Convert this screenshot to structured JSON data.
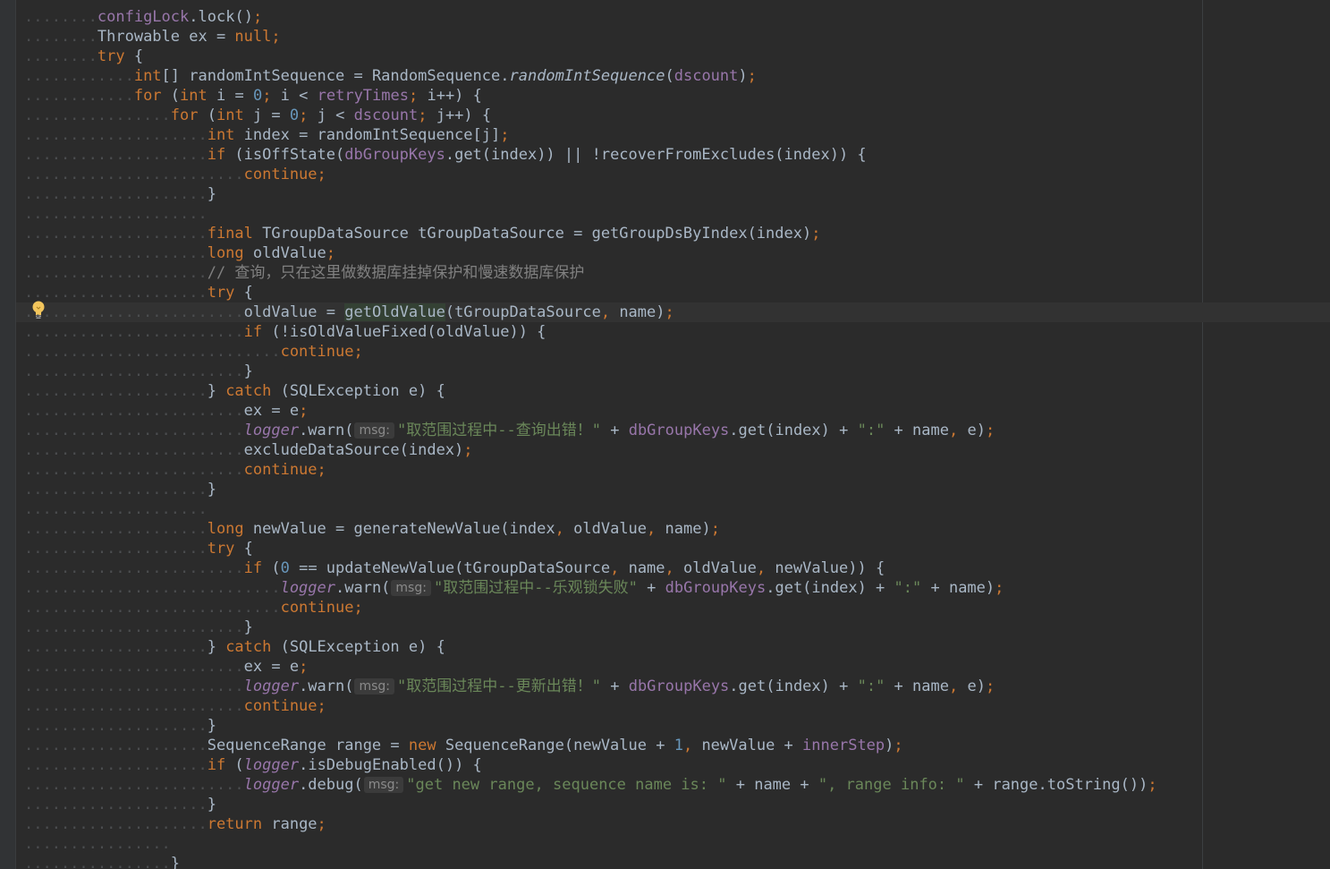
{
  "editor": {
    "inlay_hint_label": "msg:",
    "lines": [
      {
        "indent": 2,
        "tokens": [
          [
            "fld",
            "configLock"
          ],
          [
            "",
            "."
          ],
          [
            "",
            "lock"
          ],
          [
            "",
            "()"
          ],
          [
            "kw",
            ";"
          ]
        ]
      },
      {
        "indent": 2,
        "tokens": [
          [
            "",
            "Throwable ex = "
          ],
          [
            "kw",
            "null"
          ],
          [
            "kw",
            ";"
          ]
        ]
      },
      {
        "indent": 2,
        "tokens": [
          [
            "kw",
            "try"
          ],
          [
            "",
            " {"
          ]
        ]
      },
      {
        "indent": 3,
        "tokens": [
          [
            "kw",
            "int"
          ],
          [
            "",
            "[] randomIntSequence = RandomSequence."
          ],
          [
            "it",
            "randomIntSequence"
          ],
          [
            "",
            "("
          ],
          [
            "fld",
            "dscount"
          ],
          [
            "",
            ")"
          ],
          [
            "kw",
            ";"
          ]
        ]
      },
      {
        "indent": 3,
        "tokens": [
          [
            "kw",
            "for"
          ],
          [
            "",
            " ("
          ],
          [
            "kw",
            "int"
          ],
          [
            "",
            " i = "
          ],
          [
            "num",
            "0"
          ],
          [
            "kw",
            ";"
          ],
          [
            "",
            " i < "
          ],
          [
            "fld",
            "retryTimes"
          ],
          [
            "kw",
            ";"
          ],
          [
            "",
            " i++) {"
          ]
        ]
      },
      {
        "indent": 4,
        "tokens": [
          [
            "kw",
            "for"
          ],
          [
            "",
            " ("
          ],
          [
            "kw",
            "int"
          ],
          [
            "",
            " j = "
          ],
          [
            "num",
            "0"
          ],
          [
            "kw",
            ";"
          ],
          [
            "",
            " j < "
          ],
          [
            "fld",
            "dscount"
          ],
          [
            "kw",
            ";"
          ],
          [
            "",
            " j++) {"
          ]
        ]
      },
      {
        "indent": 5,
        "tokens": [
          [
            "kw",
            "int"
          ],
          [
            "",
            " index = randomIntSequence[j]"
          ],
          [
            "kw",
            ";"
          ]
        ]
      },
      {
        "indent": 5,
        "tokens": [
          [
            "kw",
            "if"
          ],
          [
            "",
            " (isOffState("
          ],
          [
            "fld",
            "dbGroupKeys"
          ],
          [
            "",
            ".get(index)) || !recoverFromExcludes(index)) {"
          ]
        ]
      },
      {
        "indent": 6,
        "tokens": [
          [
            "kw",
            "continue"
          ],
          [
            "kw",
            ";"
          ]
        ]
      },
      {
        "indent": 5,
        "tokens": [
          [
            "",
            "}"
          ]
        ]
      },
      {
        "indent": 5,
        "blank": true,
        "tokens": []
      },
      {
        "indent": 5,
        "tokens": [
          [
            "kw",
            "final"
          ],
          [
            "",
            " TGroupDataSource tGroupDataSource = getGroupDsByIndex(index)"
          ],
          [
            "kw",
            ";"
          ]
        ]
      },
      {
        "indent": 5,
        "tokens": [
          [
            "kw",
            "long"
          ],
          [
            "",
            " oldValue"
          ],
          [
            "kw",
            ";"
          ]
        ]
      },
      {
        "indent": 5,
        "tokens": [
          [
            "cmt",
            "// 查询，只在这里做数据库挂掉保护和慢速数据库保护"
          ]
        ]
      },
      {
        "indent": 5,
        "tokens": [
          [
            "kw",
            "try"
          ],
          [
            "",
            " {"
          ]
        ]
      },
      {
        "indent": 6,
        "caret": true,
        "tokens": [
          [
            "",
            "oldValue = "
          ],
          [
            "hl",
            "getOldValue"
          ],
          [
            "",
            "(tGroupDataSource"
          ],
          [
            "kw",
            ","
          ],
          [
            "",
            " name)"
          ],
          [
            "kw",
            ";"
          ]
        ]
      },
      {
        "indent": 6,
        "tokens": [
          [
            "kw",
            "if"
          ],
          [
            "",
            " (!isOldValueFixed(oldValue)) {"
          ]
        ]
      },
      {
        "indent": 7,
        "tokens": [
          [
            "kw",
            "continue"
          ],
          [
            "kw",
            ";"
          ]
        ]
      },
      {
        "indent": 6,
        "tokens": [
          [
            "",
            "}"
          ]
        ]
      },
      {
        "indent": 5,
        "tokens": [
          [
            "",
            "} "
          ],
          [
            "kw",
            "catch"
          ],
          [
            "",
            " (SQLException e) {"
          ]
        ]
      },
      {
        "indent": 6,
        "tokens": [
          [
            "",
            "ex = e"
          ],
          [
            "kw",
            ";"
          ]
        ]
      },
      {
        "indent": 6,
        "tokens": [
          [
            "sfi",
            "logger"
          ],
          [
            "",
            ".warn("
          ],
          [
            "hint",
            ""
          ],
          [
            "str",
            "\"取范围过程中--查询出错！\""
          ],
          [
            "",
            " + "
          ],
          [
            "fld",
            "dbGroupKeys"
          ],
          [
            "",
            ".get(index) + "
          ],
          [
            "str",
            "\":\""
          ],
          [
            "",
            " + name"
          ],
          [
            "kw",
            ","
          ],
          [
            "",
            " e)"
          ],
          [
            "kw",
            ";"
          ]
        ]
      },
      {
        "indent": 6,
        "tokens": [
          [
            "",
            "excludeDataSource(index)"
          ],
          [
            "kw",
            ";"
          ]
        ]
      },
      {
        "indent": 6,
        "tokens": [
          [
            "kw",
            "continue"
          ],
          [
            "kw",
            ";"
          ]
        ]
      },
      {
        "indent": 5,
        "tokens": [
          [
            "",
            "}"
          ]
        ]
      },
      {
        "indent": 5,
        "blank": true,
        "tokens": []
      },
      {
        "indent": 5,
        "tokens": [
          [
            "kw",
            "long"
          ],
          [
            "",
            " newValue = generateNewValue(index"
          ],
          [
            "kw",
            ","
          ],
          [
            "",
            " oldValue"
          ],
          [
            "kw",
            ","
          ],
          [
            "",
            " name)"
          ],
          [
            "kw",
            ";"
          ]
        ]
      },
      {
        "indent": 5,
        "tokens": [
          [
            "kw",
            "try"
          ],
          [
            "",
            " {"
          ]
        ]
      },
      {
        "indent": 6,
        "tokens": [
          [
            "kw",
            "if"
          ],
          [
            "",
            " ("
          ],
          [
            "num",
            "0"
          ],
          [
            "",
            " == updateNewValue(tGroupDataSource"
          ],
          [
            "kw",
            ","
          ],
          [
            "",
            " name"
          ],
          [
            "kw",
            ","
          ],
          [
            "",
            " oldValue"
          ],
          [
            "kw",
            ","
          ],
          [
            "",
            " newValue)) {"
          ]
        ]
      },
      {
        "indent": 7,
        "tokens": [
          [
            "sfi",
            "logger"
          ],
          [
            "",
            ".warn("
          ],
          [
            "hint",
            ""
          ],
          [
            "str",
            "\"取范围过程中--乐观锁失败\""
          ],
          [
            "",
            " + "
          ],
          [
            "fld",
            "dbGroupKeys"
          ],
          [
            "",
            ".get(index) + "
          ],
          [
            "str",
            "\":\""
          ],
          [
            "",
            " + name)"
          ],
          [
            "kw",
            ";"
          ]
        ]
      },
      {
        "indent": 7,
        "tokens": [
          [
            "kw",
            "continue"
          ],
          [
            "kw",
            ";"
          ]
        ]
      },
      {
        "indent": 6,
        "tokens": [
          [
            "",
            "}"
          ]
        ]
      },
      {
        "indent": 5,
        "tokens": [
          [
            "",
            "} "
          ],
          [
            "kw",
            "catch"
          ],
          [
            "",
            " (SQLException e) {"
          ]
        ]
      },
      {
        "indent": 6,
        "tokens": [
          [
            "",
            "ex = e"
          ],
          [
            "kw",
            ";"
          ]
        ]
      },
      {
        "indent": 6,
        "tokens": [
          [
            "sfi",
            "logger"
          ],
          [
            "",
            ".warn("
          ],
          [
            "hint",
            ""
          ],
          [
            "str",
            "\"取范围过程中--更新出错！\""
          ],
          [
            "",
            " + "
          ],
          [
            "fld",
            "dbGroupKeys"
          ],
          [
            "",
            ".get(index) + "
          ],
          [
            "str",
            "\":\""
          ],
          [
            "",
            " + name"
          ],
          [
            "kw",
            ","
          ],
          [
            "",
            " e)"
          ],
          [
            "kw",
            ";"
          ]
        ]
      },
      {
        "indent": 6,
        "tokens": [
          [
            "kw",
            "continue"
          ],
          [
            "kw",
            ";"
          ]
        ]
      },
      {
        "indent": 5,
        "tokens": [
          [
            "",
            "}"
          ]
        ]
      },
      {
        "indent": 5,
        "tokens": [
          [
            "",
            "SequenceRange range = "
          ],
          [
            "kw",
            "new"
          ],
          [
            "",
            " SequenceRange(newValue + "
          ],
          [
            "num",
            "1"
          ],
          [
            "kw",
            ","
          ],
          [
            "",
            " newValue + "
          ],
          [
            "fld",
            "innerStep"
          ],
          [
            "",
            ")"
          ],
          [
            "kw",
            ";"
          ]
        ]
      },
      {
        "indent": 5,
        "tokens": [
          [
            "kw",
            "if"
          ],
          [
            "",
            " ("
          ],
          [
            "sfi",
            "logger"
          ],
          [
            "",
            ".isDebugEnabled()) {"
          ]
        ]
      },
      {
        "indent": 6,
        "tokens": [
          [
            "sfi",
            "logger"
          ],
          [
            "",
            ".debug("
          ],
          [
            "hint",
            ""
          ],
          [
            "str",
            "\"get new range, sequence name is: \""
          ],
          [
            "",
            " + name + "
          ],
          [
            "str",
            "\", range info: \""
          ],
          [
            "",
            " + range.toString())"
          ],
          [
            "kw",
            ";"
          ]
        ]
      },
      {
        "indent": 5,
        "tokens": [
          [
            "",
            "}"
          ]
        ]
      },
      {
        "indent": 5,
        "tokens": [
          [
            "kw",
            "return"
          ],
          [
            "",
            " range"
          ],
          [
            "kw",
            ";"
          ]
        ]
      },
      {
        "indent": 4,
        "blank": true,
        "tokens": []
      },
      {
        "indent": 4,
        "tokens": [
          [
            "",
            "}"
          ]
        ]
      }
    ]
  }
}
